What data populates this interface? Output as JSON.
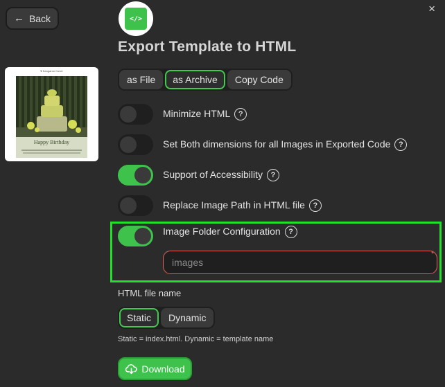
{
  "nav": {
    "back_label": "Back",
    "close_label": "×"
  },
  "preview": {
    "header_text": "♥ Kangaroo Cover",
    "poster_caption": "Happy Birthday"
  },
  "dialog": {
    "logo_glyph": "</>",
    "title": "Export Template to HTML",
    "export_options": [
      {
        "label": "as File",
        "active": false
      },
      {
        "label": "as Archive",
        "active": true
      },
      {
        "label": "Copy Code",
        "active": false
      }
    ],
    "toggles": [
      {
        "label": "Minimize HTML",
        "on": false
      },
      {
        "label": "Set Both dimensions for all Images in Exported Code",
        "on": false
      },
      {
        "label": "Support of Accessibility",
        "on": true
      },
      {
        "label": "Replace Image Path in HTML file",
        "on": false
      },
      {
        "label": "Image Folder Configuration",
        "on": true
      }
    ],
    "help_glyph": "?",
    "image_folder": {
      "value": "",
      "placeholder": "images",
      "required_mark": "*"
    },
    "file_name_section": {
      "label": "HTML file name",
      "options": [
        {
          "label": "Static",
          "active": true
        },
        {
          "label": "Dynamic",
          "active": false
        }
      ],
      "hint": "Static = index.html. Dynamic = template name"
    },
    "download_label": "Download"
  },
  "colors": {
    "accent": "#3ec24c",
    "highlight": "#22e02c",
    "error": "#e06459",
    "background": "#2b2b2b"
  }
}
